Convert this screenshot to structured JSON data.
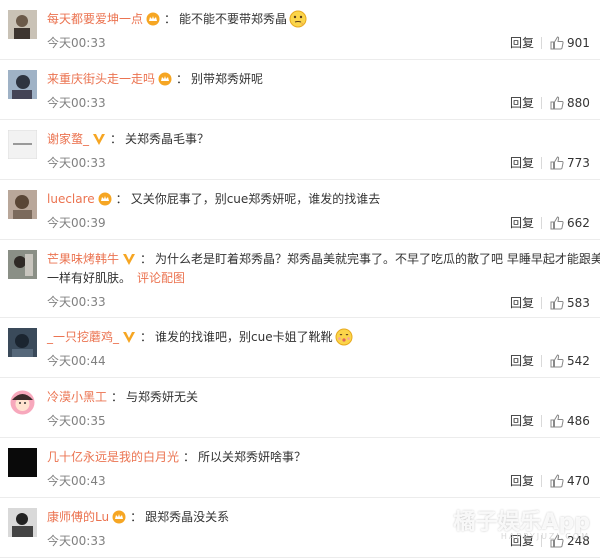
{
  "comments": [
    {
      "user": "每天都要爱坤一点",
      "text": "能不能不要带郑秀晶",
      "time": "今天00:33",
      "reply": "回复",
      "likes": "901",
      "badge": "crown",
      "emoji": "face-thinking"
    },
    {
      "user": "来重庆街头走一走吗",
      "text": "别带郑秀妍呢",
      "time": "今天00:33",
      "reply": "回复",
      "likes": "880",
      "badge": "crown"
    },
    {
      "user": "谢家蝥_",
      "text": "关郑秀晶毛事？",
      "time": "今天00:33",
      "reply": "回复",
      "likes": "773",
      "badge": "v-gold"
    },
    {
      "user": "lueclare",
      "text": "又关你屁事了，别cue郑秀妍呢，谁发的找谁去",
      "time": "今天00:39",
      "reply": "回复",
      "likes": "662",
      "badge": "crown"
    },
    {
      "user": "芒果味烤韩牛",
      "text": "为什么老是盯着郑秀晶？郑秀晶美就完事了。不早了吃瓜的散了吧 早睡早起才能跟美女",
      "text2": "一样有好肌肤。",
      "link": "评论配图",
      "time": "今天00:33",
      "reply": "回复",
      "likes": "583",
      "badge": "v-gold"
    },
    {
      "user": "_一只挖蘑鸡_",
      "text": "谁发的找谁吧，别cue卡姐了靴靴",
      "time": "今天00:44",
      "reply": "回复",
      "likes": "542",
      "badge": "v-gold",
      "emoji": "face-cute"
    },
    {
      "user": "冷漠小黑工",
      "text": "与郑秀妍无关",
      "time": "今天00:35",
      "reply": "回复",
      "likes": "486"
    },
    {
      "user": "几十亿永远是我的白月光",
      "text": "所以关郑秀妍啥事？",
      "time": "今天00:43",
      "reply": "回复",
      "likes": "470"
    },
    {
      "user": "康师傅的Lu",
      "text": "跟郑秀晶没关系",
      "time": "今天00:33",
      "reply": "回复",
      "likes": "248",
      "badge": "crown"
    }
  ],
  "watermark": {
    "main": "橘子娱乐App",
    "sub": "HAPPYJUZI.COM"
  },
  "colors": {
    "username": "#eb7350",
    "text": "#333333",
    "time": "#808080",
    "divider": "#ececec"
  },
  "icons": {
    "like": "thumbs-up-icon",
    "crown-badge": "crown-badge-icon",
    "v-badge": "vip-v-badge-icon"
  }
}
